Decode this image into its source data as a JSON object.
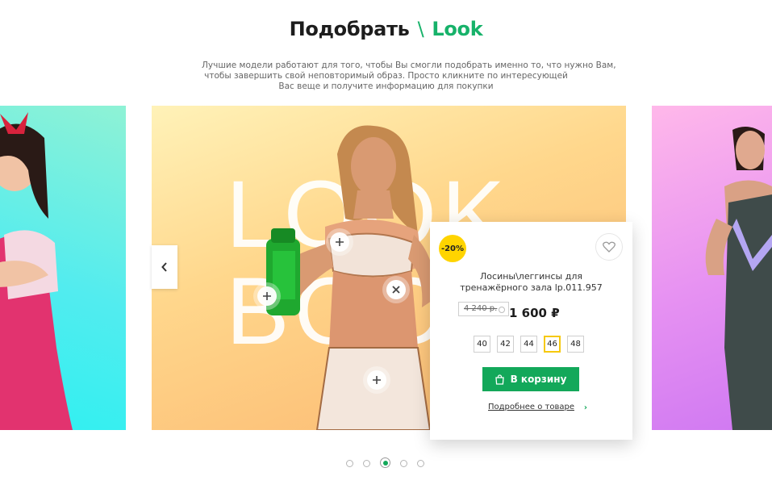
{
  "header": {
    "title_part1": "Подобрать",
    "separator": "\\",
    "title_part2": "Look"
  },
  "intro": {
    "line1": "Лучшие модели работают для того, чтобы Вы смогли подобрать именно то, что нужно Вам,",
    "line2": "чтобы завершить свой неповторимый образ. Просто кликните по интересующей",
    "line3": "Вас веще и получите информацию для покупки"
  },
  "slide": {
    "word_line1": "LOOK",
    "word_line2": "BOOK"
  },
  "popup": {
    "discount": "-20%",
    "product_name": "Лосины\\леггинсы для тренажёрного зала lp.011.957",
    "old_price": "4 240 р.",
    "new_price": "1 600 ₽",
    "sizes": [
      "40",
      "42",
      "44",
      "46",
      "48"
    ],
    "selected_size": "46",
    "cart_label": "В корзину",
    "details_label": "Подробнее о товаре"
  },
  "carousel": {
    "total": 5,
    "active_index": 3
  },
  "colors": {
    "accent": "#13a85a",
    "badge": "#ffd400",
    "size_selected": "#f6c90e"
  },
  "icons": {
    "heart": "heart-icon",
    "bag": "shopping-bag-icon",
    "arrow_left": "chevron-left-icon",
    "plus": "plus-icon",
    "close": "close-icon",
    "chevron_right": "chevron-right-icon"
  }
}
